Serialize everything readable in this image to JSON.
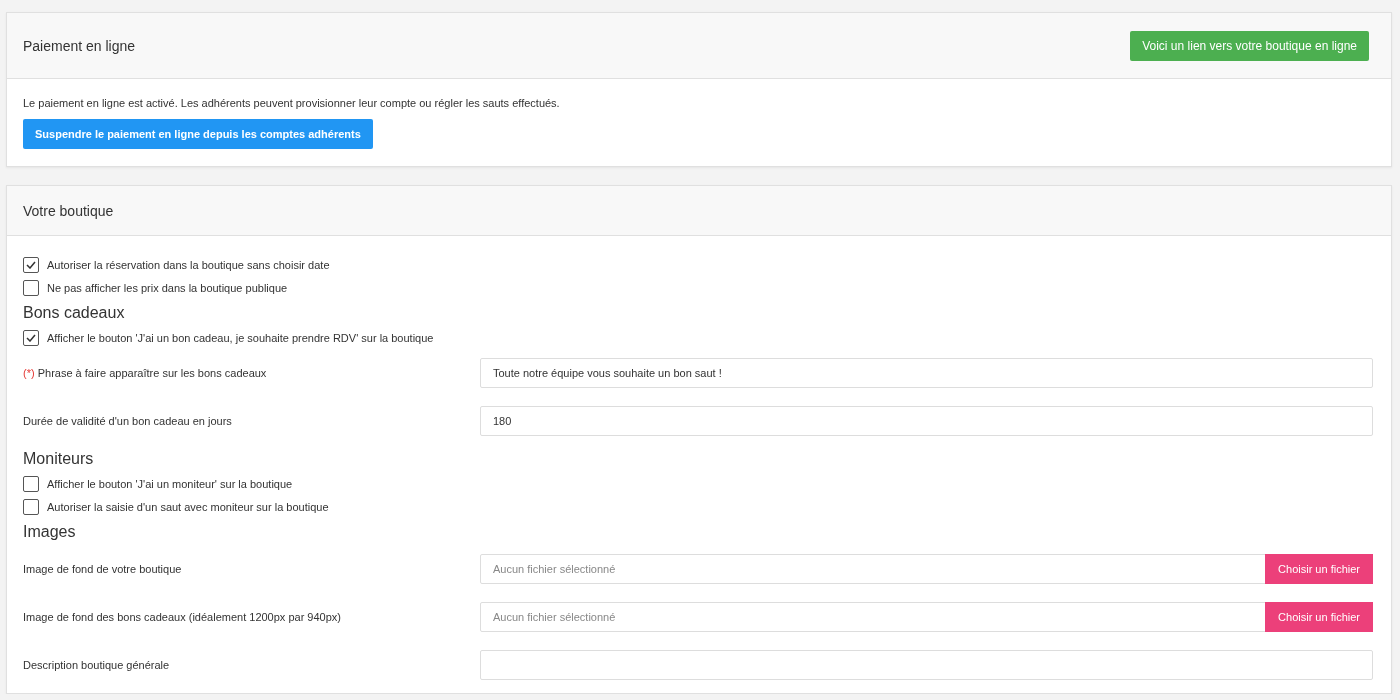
{
  "payment": {
    "title": "Paiement en ligne",
    "link_button": "Voici un lien vers votre boutique en ligne",
    "status_text": "Le paiement en ligne est activé. Les adhérents peuvent provisionner leur compte ou régler les sauts effectués.",
    "suspend_button": "Suspendre le paiement en ligne depuis les comptes adhérents"
  },
  "shop": {
    "title": "Votre boutique",
    "items": [
      {
        "kind": "checkbox",
        "label": "Autoriser la réservation dans la boutique sans choisir date",
        "checked": true
      },
      {
        "kind": "checkbox",
        "label": "Ne pas afficher les prix dans la boutique publique",
        "checked": false
      },
      {
        "kind": "heading",
        "label": "Bons cadeaux"
      },
      {
        "kind": "checkbox",
        "label": "Afficher le bouton 'J'ai un bon cadeau, je souhaite prendre RDV' sur la boutique",
        "checked": true
      },
      {
        "kind": "text",
        "label": "Phrase à faire apparaître sur les bons cadeaux",
        "required_mark": "(*)",
        "value": "Toute notre équipe vous souhaite un bon saut !"
      },
      {
        "kind": "text",
        "label": "Durée de validité d'un bon cadeau en jours",
        "value": "180"
      },
      {
        "kind": "heading",
        "label": "Moniteurs"
      },
      {
        "kind": "checkbox",
        "label": "Afficher le bouton 'J'ai un moniteur' sur la boutique",
        "checked": false
      },
      {
        "kind": "checkbox",
        "label": "Autoriser la saisie d'un saut avec moniteur sur la boutique",
        "checked": false
      },
      {
        "kind": "heading",
        "label": "Images"
      },
      {
        "kind": "file",
        "label": "Image de fond de votre boutique",
        "placeholder": "Aucun fichier sélectionné",
        "button": "Choisir un fichier"
      },
      {
        "kind": "file",
        "label": "Image de fond des bons cadeaux (idéalement 1200px par 940px)",
        "placeholder": "Aucun fichier sélectionné",
        "button": "Choisir un fichier"
      },
      {
        "kind": "text",
        "label": "Description boutique générale",
        "value": ""
      }
    ]
  }
}
